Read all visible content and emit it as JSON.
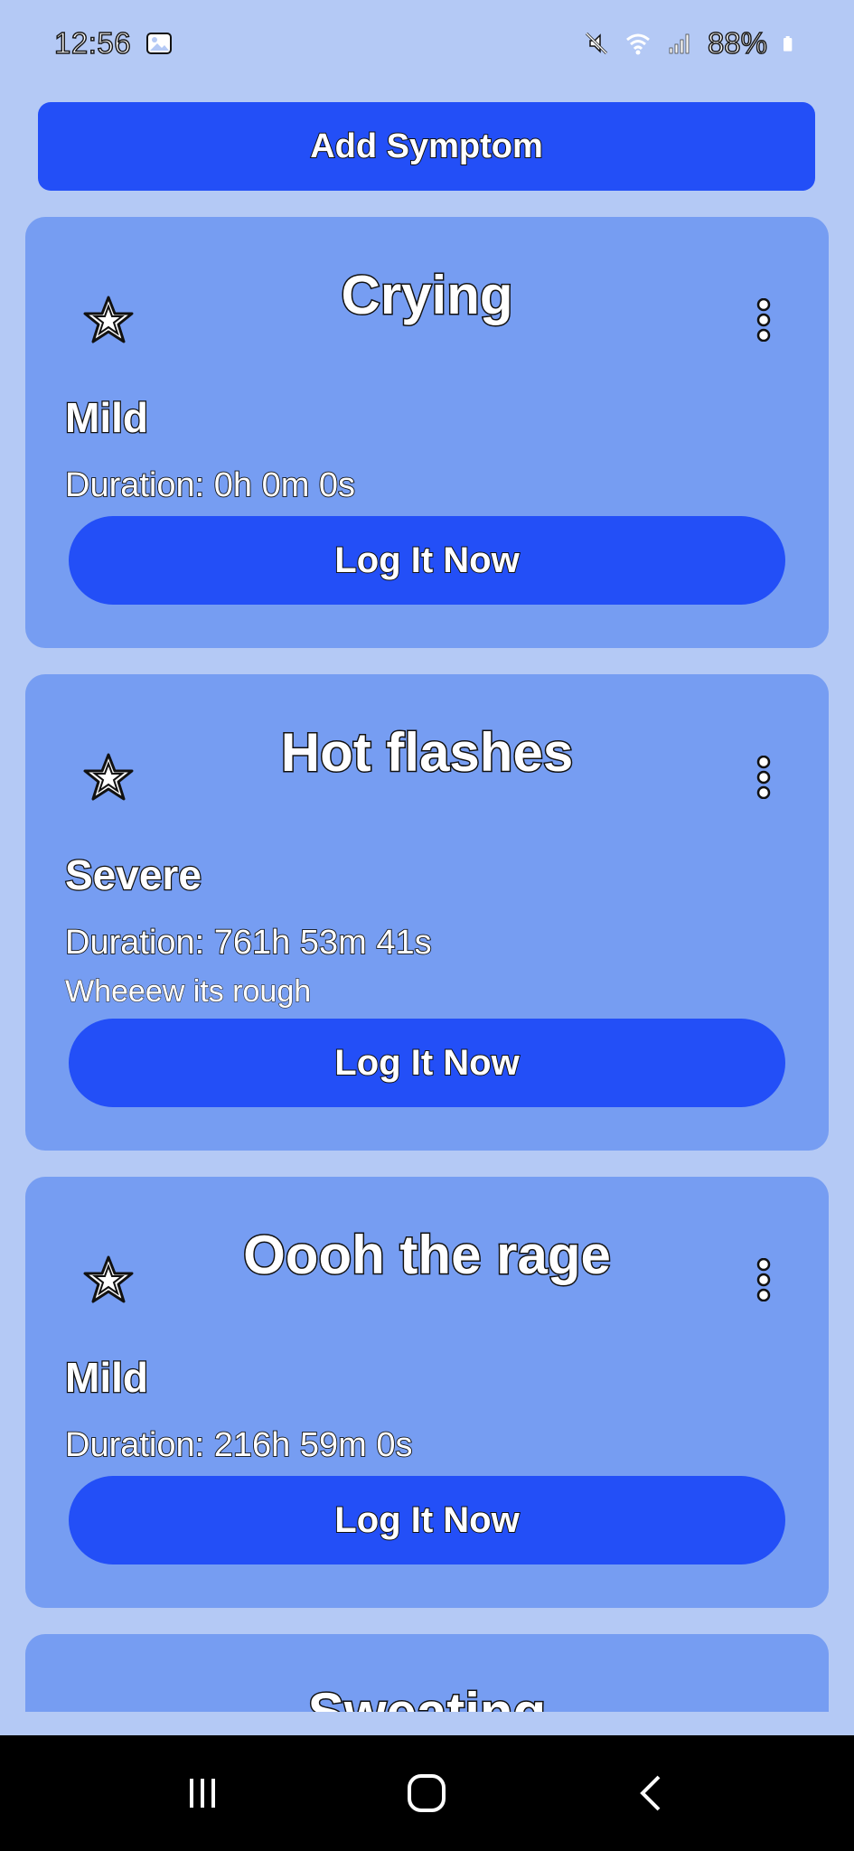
{
  "status_bar": {
    "time": "12:56",
    "battery": "88%",
    "icons": [
      "gallery-icon",
      "mute-icon",
      "wifi-icon",
      "signal-icon",
      "battery-icon"
    ]
  },
  "add_button_label": "Add Symptom",
  "symptoms": [
    {
      "name": "Crying",
      "severity": "Mild",
      "duration": "Duration: 0h 0m 0s",
      "note": "",
      "log_label": "Log It Now"
    },
    {
      "name": "Hot flashes",
      "severity": "Severe",
      "duration": "Duration: 761h 53m 41s",
      "note": "Wheeew its rough",
      "log_label": "Log It Now"
    },
    {
      "name": "Oooh the rage",
      "severity": "Mild",
      "duration": "Duration: 216h 59m 0s",
      "note": "",
      "log_label": "Log It Now"
    },
    {
      "name": "Sweating",
      "severity": "",
      "duration": "",
      "note": "",
      "log_label": ""
    }
  ],
  "colors": {
    "background": "#b4c9f5",
    "card": "#769df2",
    "button": "#234ff7",
    "nav_bar": "#000000"
  },
  "nav": [
    "recents-icon",
    "home-icon",
    "back-icon"
  ]
}
